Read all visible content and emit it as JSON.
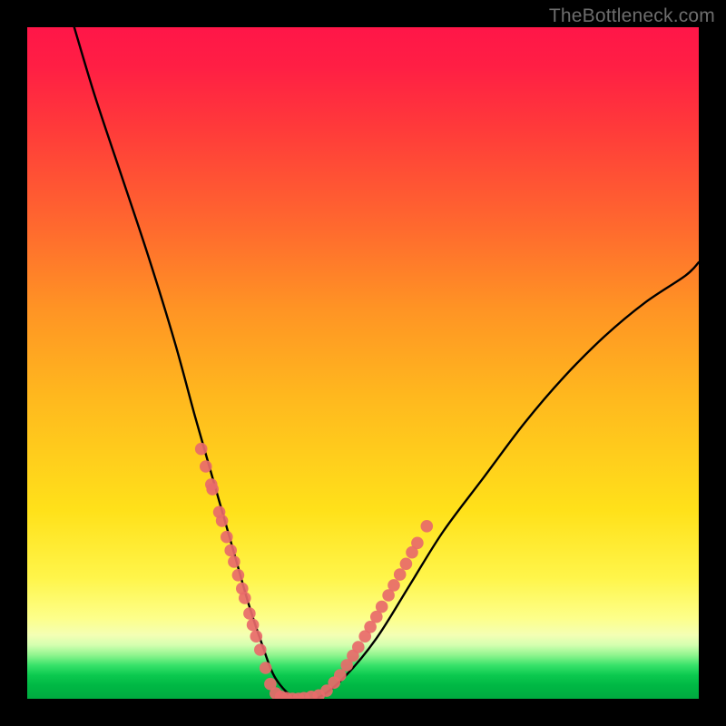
{
  "watermark": "TheBottleneck.com",
  "chart_data": {
    "type": "line",
    "title": "",
    "xlabel": "",
    "ylabel": "",
    "xlim": [
      0,
      100
    ],
    "ylim": [
      0,
      100
    ],
    "grid": false,
    "legend": false,
    "note": "values estimated from pixels; x/y in percent of plot area, origin bottom-left",
    "series": [
      {
        "name": "bottleneck-curve",
        "type": "line",
        "x": [
          7,
          10,
          14,
          18,
          22,
          25,
          27,
          29,
          31,
          33,
          35,
          37,
          40,
          43,
          47,
          52,
          57,
          62,
          68,
          74,
          80,
          86,
          92,
          98,
          100
        ],
        "y": [
          100,
          90,
          78,
          66,
          53,
          42,
          35,
          28,
          21,
          14,
          8,
          3,
          0,
          0,
          3,
          9,
          17,
          25,
          33,
          41,
          48,
          54,
          59,
          63,
          65
        ]
      },
      {
        "name": "highlight-dots-left",
        "type": "scatter",
        "color": "#e86a6a",
        "x": [
          25.9,
          26.6,
          27.4,
          27.6,
          28.6,
          29.0,
          29.7,
          30.3,
          30.8,
          31.4,
          32.0,
          32.4,
          33.1,
          33.6,
          34.1,
          34.7,
          35.5,
          36.2,
          37.0,
          37.8,
          38.6,
          39.5,
          40.4,
          41.2
        ],
        "y": [
          37.2,
          34.6,
          31.9,
          31.2,
          27.8,
          26.5,
          24.1,
          22.1,
          20.4,
          18.4,
          16.4,
          15.0,
          12.7,
          11.0,
          9.3,
          7.3,
          4.6,
          2.2,
          0.8,
          0.3,
          0.1,
          0.0,
          0.0,
          0.1
        ]
      },
      {
        "name": "highlight-dots-right",
        "type": "scatter",
        "color": "#e86a6a",
        "x": [
          42.3,
          43.4,
          44.6,
          45.7,
          46.6,
          47.6,
          48.5,
          49.3,
          50.3,
          51.1,
          52.0,
          52.8,
          53.8,
          54.6,
          55.5,
          56.4,
          57.3,
          58.1,
          59.5
        ],
        "y": [
          0.3,
          0.5,
          1.2,
          2.4,
          3.5,
          5.0,
          6.4,
          7.7,
          9.3,
          10.7,
          12.2,
          13.7,
          15.4,
          16.9,
          18.5,
          20.1,
          21.8,
          23.2,
          25.7
        ]
      }
    ],
    "background_gradient_stops": [
      {
        "pos": 0.0,
        "color": "#ff1648"
      },
      {
        "pos": 0.3,
        "color": "#ff6a2e"
      },
      {
        "pos": 0.55,
        "color": "#ffb81e"
      },
      {
        "pos": 0.82,
        "color": "#fff54a"
      },
      {
        "pos": 0.905,
        "color": "#f4ffb4"
      },
      {
        "pos": 0.95,
        "color": "#38e26a"
      },
      {
        "pos": 1.0,
        "color": "#00aa40"
      }
    ]
  }
}
